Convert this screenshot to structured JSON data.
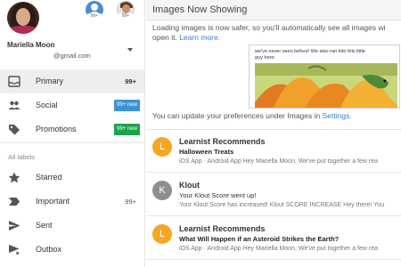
{
  "account": {
    "name": "Mariella Moon",
    "email": "@gmail.com",
    "other_accounts": [
      {
        "count": "99+"
      },
      {
        "count": "99+"
      }
    ]
  },
  "nav": {
    "items": [
      {
        "label": "Primary",
        "count": "99+",
        "icon": "inbox-icon"
      },
      {
        "label": "Social",
        "badge": "99+ new",
        "icon": "people-icon",
        "badge_color": "#3b93d7"
      },
      {
        "label": "Promotions",
        "badge": "99+ new",
        "icon": "tag-icon",
        "badge_color": "#19a44a"
      }
    ],
    "section_label": "All labels",
    "labels": [
      {
        "label": "Starred",
        "icon": "star-icon"
      },
      {
        "label": "Important",
        "count": "99+",
        "icon": "important-icon"
      },
      {
        "label": "Sent",
        "icon": "send-icon"
      },
      {
        "label": "Outbox",
        "icon": "outbox-icon"
      }
    ]
  },
  "pane": {
    "title": "Images Now Showing",
    "desc_line1": "Loading images is now safer, so you'll automatically see all images wi",
    "desc_line2": "open it.",
    "learn_more": "Learn more.",
    "preview_text_line1": "we've never seen before! We also ran into this little",
    "preview_text_line2": "guy here:",
    "pref_text": "You can update your preferences under Images in",
    "pref_link": "Settings."
  },
  "emails": [
    {
      "initial": "L",
      "sender": "Learnist Recommends",
      "subject": "Halloween Treats",
      "snippet": "iOS App · Android App Hey Mariella Moon, We've put together a few rea",
      "color": "#f5a623"
    },
    {
      "initial": "K",
      "sender": "Klout",
      "subject": "Your Klout Score went up!",
      "snippet": "Your Klout Score has increased! Klout SCORE INCREASE Hey there! You",
      "color": "#8e8e8e"
    },
    {
      "initial": "L",
      "sender": "Learnist Recommends",
      "subject": "What Will Happen if an Asteroid Strikes the Earth?",
      "snippet": "iOS App · Android App Hey Mariella Moon, We've put together a few rea",
      "color": "#f5a623"
    }
  ],
  "colors": {
    "accent_link": "#3a7fc9",
    "badge_blue": "#3b93d7",
    "badge_green": "#19a44a"
  }
}
